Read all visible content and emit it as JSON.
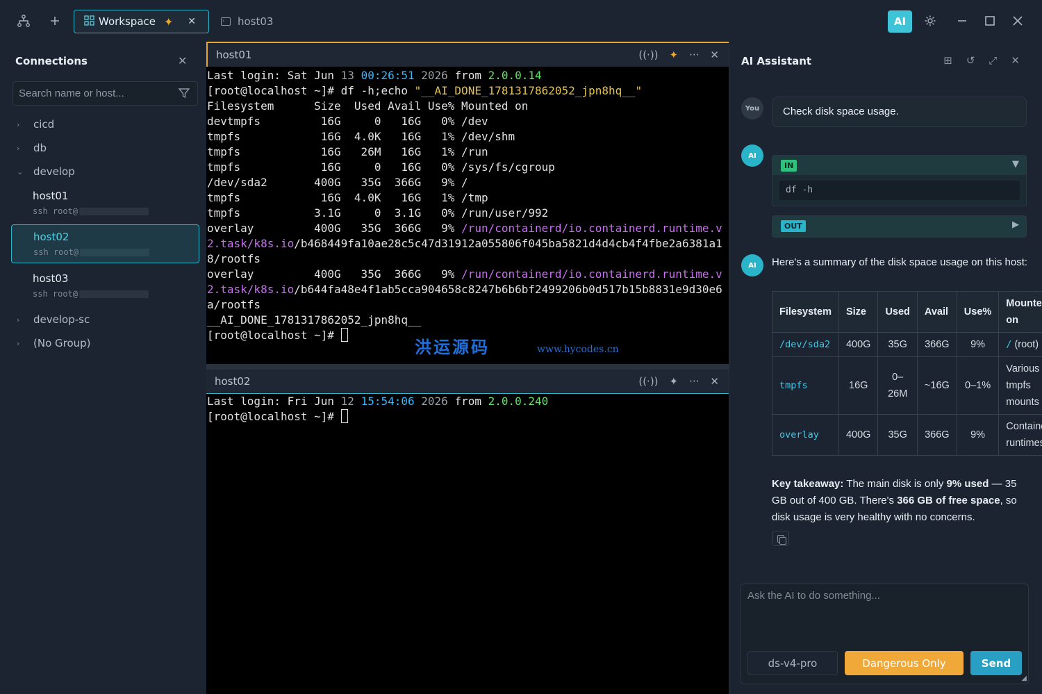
{
  "titlebar": {
    "tabs": [
      {
        "label": "Workspace",
        "active": true
      },
      {
        "label": "host03",
        "active": false
      }
    ],
    "ai_badge": "AI"
  },
  "sidebar": {
    "title": "Connections",
    "search_placeholder": "Search name or host...",
    "groups": [
      {
        "label": "cicd",
        "expanded": false
      },
      {
        "label": "db",
        "expanded": false
      },
      {
        "label": "develop",
        "expanded": true
      },
      {
        "label": "develop-sc",
        "expanded": false
      },
      {
        "label": "(No Group)",
        "expanded": false
      }
    ],
    "hosts": [
      {
        "name": "host01",
        "sub": "ssh root@"
      },
      {
        "name": "host02",
        "sub": "ssh root@",
        "selected": true
      },
      {
        "name": "host03",
        "sub": "ssh root@"
      }
    ]
  },
  "terminal1": {
    "title": "host01",
    "login": {
      "prefix": "Last login: Sat Jun ",
      "day": "13",
      "time": "00:26:51",
      "year": "2026",
      "from": "from",
      "ip": "2.0.0.14"
    },
    "prompt": "[root@localhost ~]#",
    "command": " df -h;echo ",
    "echo_arg": "\"__AI_DONE_1781317862052_jpn8hq__\"",
    "df_header": "Filesystem      Size  Used Avail Use% Mounted on",
    "df_rows": [
      "devtmpfs         16G     0   16G   0% /dev",
      "tmpfs            16G  4.0K   16G   1% /dev/shm",
      "tmpfs            16G   26M   16G   1% /run",
      "tmpfs            16G     0   16G   0% /sys/fs/cgroup",
      "/dev/sda2       400G   35G  366G   9% /",
      "tmpfs            16G  4.0K   16G   1% /tmp",
      "tmpfs           3.1G     0  3.1G   0% /run/user/992"
    ],
    "overlay1": {
      "left": "overlay         400G   35G  366G   9% ",
      "path1": "/run/containerd/io.containerd.runtime.v",
      "path2": "2.task/k8s.io",
      "rest": "/b468449fa10ae28c5c47d31912a055806f045ba5821d4d4cb4f4fbe2a6381a1",
      "tail": "8/rootfs"
    },
    "overlay2": {
      "left": "overlay         400G   35G  366G   9% ",
      "path1": "/run/containerd/io.containerd.runtime.v",
      "path2": "2.task/k8s.io",
      "rest": "/b644fa48e4f1ab5cca904658c8247b6b6bf2499206b0d517b15b8831e9d30e6",
      "tail": "a/rootfs"
    },
    "done_marker": "__AI_DONE_1781317862052_jpn8hq__",
    "watermark": "洪运源码",
    "watermark_url": "www.hycodes.cn"
  },
  "terminal2": {
    "title": "host02",
    "login": {
      "prefix": "Last login: Fri Jun ",
      "day": "12",
      "time": "15:54:06",
      "year": "2026",
      "from": "from",
      "ip": "2.0.0.240"
    },
    "prompt": "[root@localhost ~]#"
  },
  "ai_panel": {
    "title": "AI Assistant",
    "user_avatar": "You",
    "ai_avatar": "AI",
    "user_message": "Check disk space usage.",
    "tool": {
      "in_label": "IN",
      "out_label": "OUT",
      "command": "df -h"
    },
    "summary_intro": "Here's a summary of the disk space usage on this host:",
    "table": {
      "headers": [
        "Filesystem",
        "Size",
        "Used",
        "Avail",
        "Use%",
        "Mounted on"
      ],
      "rows": [
        {
          "fs": "/dev/sda2",
          "size": "400G",
          "used": "35G",
          "avail": "366G",
          "use": "9%",
          "mount_code": "/",
          "mount_text": " (root)"
        },
        {
          "fs": "tmpfs",
          "size": "16G",
          "used": "0–26M",
          "avail": "~16G",
          "use": "0–1%",
          "mount_code": "",
          "mount_text": "Various tmpfs mounts"
        },
        {
          "fs": "overlay",
          "size": "400G",
          "used": "35G",
          "avail": "366G",
          "use": "9%",
          "mount_code": "",
          "mount_text": "Container runtimes"
        }
      ]
    },
    "takeaway": {
      "label": "Key takeaway:",
      "t1": " The main disk is only ",
      "b1": "9% used",
      "t2": " — 35 GB out of 400 GB. There's ",
      "b2": "366 GB of free space",
      "t3": ", so disk usage is very healthy with no concerns."
    },
    "input_placeholder": "Ask the AI to do something...",
    "model": "ds-v4-pro",
    "mode_button": "Dangerous Only",
    "send_button": "Send"
  }
}
